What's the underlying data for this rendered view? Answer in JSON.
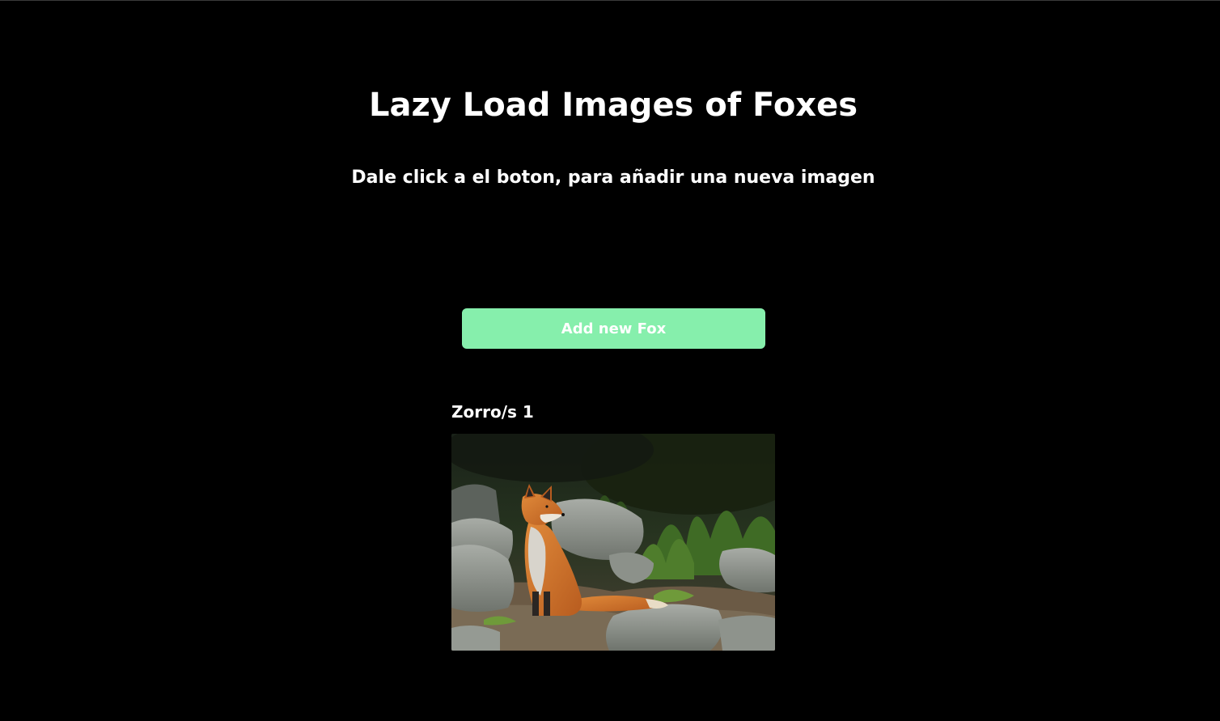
{
  "header": {
    "title": "Lazy Load Images of Foxes",
    "subtitle": "Dale click a el boton, para añadir una nueva imagen"
  },
  "actions": {
    "add_label": "Add new Fox"
  },
  "colors": {
    "background": "#000000",
    "text": "#ffffff",
    "button": "#86efac"
  },
  "foxes": [
    {
      "caption": "Zorro/s 1",
      "image": "fox-photo"
    }
  ]
}
